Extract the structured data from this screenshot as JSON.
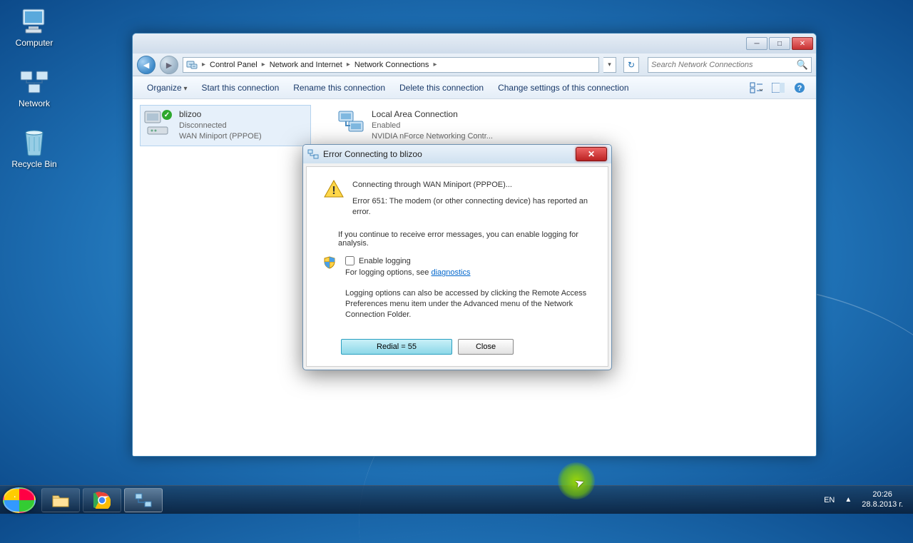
{
  "desktop": {
    "icons": [
      "Computer",
      "Network",
      "Recycle Bin"
    ]
  },
  "explorer": {
    "window_controls": {
      "min": "─",
      "max": "□",
      "close": "✕"
    },
    "breadcrumb": [
      "Control Panel",
      "Network and Internet",
      "Network Connections"
    ],
    "search_placeholder": "Search Network Connections",
    "toolbar": {
      "organize": "Organize",
      "start": "Start this connection",
      "rename": "Rename this connection",
      "delete": "Delete this connection",
      "change": "Change settings of this connection"
    },
    "connections": [
      {
        "name": "blizoo",
        "status": "Disconnected",
        "device": "WAN Miniport (PPPOE)",
        "selected": true
      },
      {
        "name": "Local Area Connection",
        "status": "Enabled",
        "device": "NVIDIA nForce Networking Contr...",
        "selected": false
      }
    ]
  },
  "dialog": {
    "title": "Error Connecting to blizoo",
    "line1": "Connecting through WAN Miniport (PPPOE)...",
    "error": "Error 651: The modem (or other connecting device) has reported an error.",
    "hint": "If you continue to receive error messages, you can enable logging for analysis.",
    "enable_logging": "Enable logging",
    "logging_prefix": "For logging options, see ",
    "logging_link": "diagnostics",
    "logging_note": "Logging options can also be accessed by clicking the Remote Access Preferences menu item under the Advanced menu of the Network Connection Folder.",
    "redial": "Redial = 55",
    "close": "Close"
  },
  "taskbar": {
    "lang": "EN",
    "time": "20:26",
    "date": "28.8.2013 г."
  }
}
